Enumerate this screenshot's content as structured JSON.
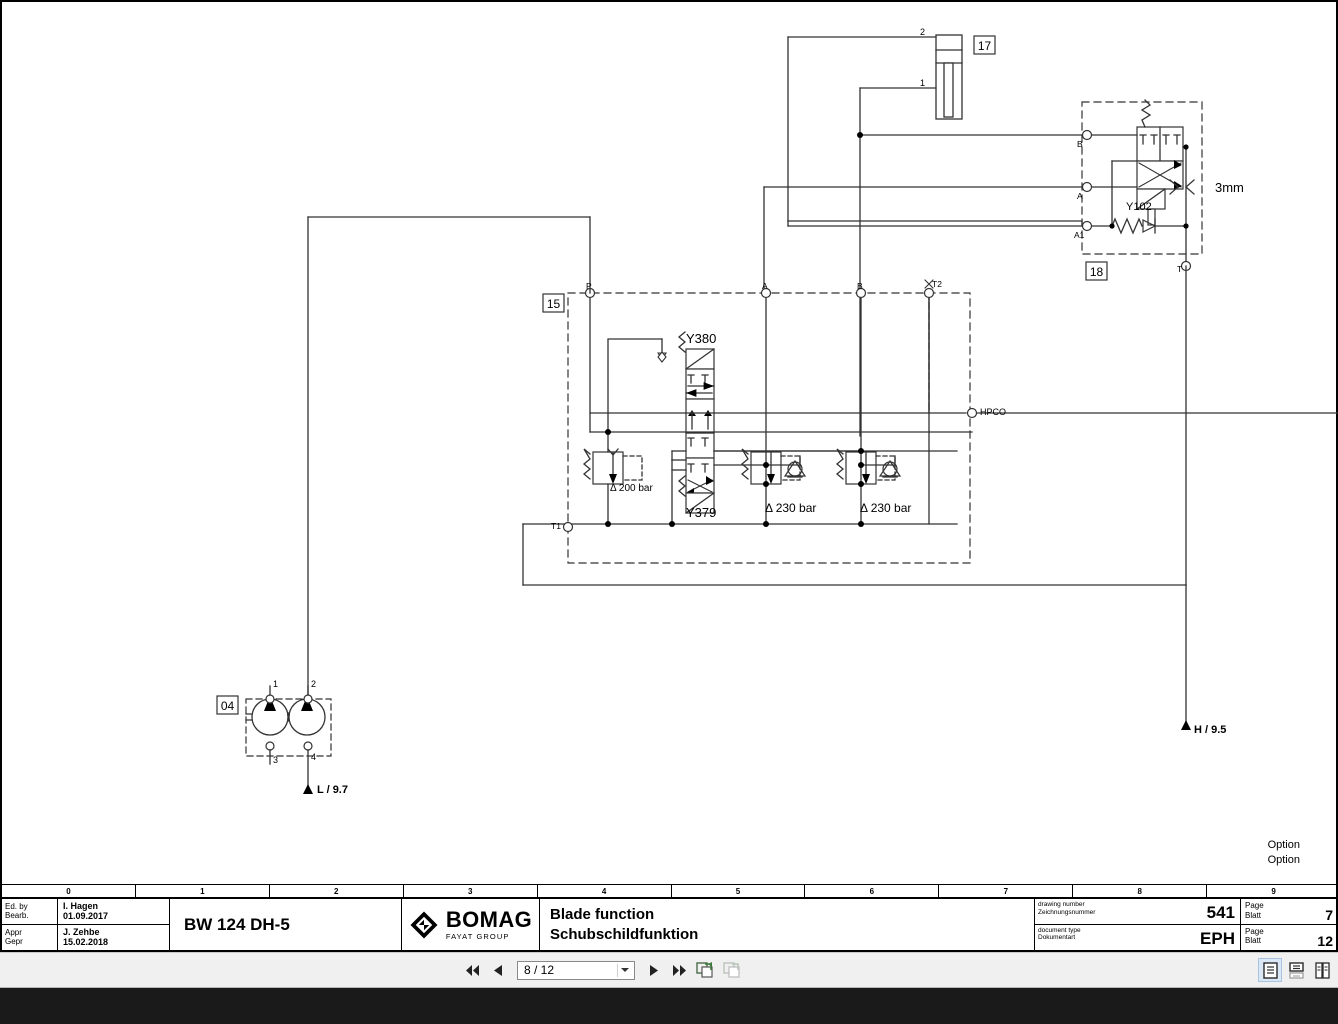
{
  "document": {
    "model": "BW 124 DH-5",
    "title_en": "Blade function",
    "title_de": "Schubschildfunktion",
    "brand": "BOMAG",
    "brand_sub": "FAYAT GROUP",
    "edited_by_label_en": "Ed. by",
    "edited_by_label_de": "Bearb.",
    "approved_label_en": "Appr",
    "approved_label_de": "Gepr",
    "editor_name": "I. Hagen",
    "editor_date": "01.09.2017",
    "approver_name": "J. Zehbe",
    "approver_date": "15.02.2018",
    "drawing_number_label_en": "drawing number",
    "drawing_number_label_de": "Zeichnungsnummer",
    "drawing_number": "541",
    "document_type_label_en": "document type",
    "document_type_label_de": "Dokumentart",
    "document_type": "EPH",
    "page_label_en": "Page",
    "page_label_de": "Blatt",
    "sheet_page": "7",
    "total_pages": "12",
    "columns": [
      "0",
      "1",
      "2",
      "3",
      "4",
      "5",
      "6",
      "7",
      "8",
      "9"
    ],
    "options": [
      "Option",
      "Option"
    ]
  },
  "viewer": {
    "first_page_icon": "first-page-icon",
    "prev_page_icon": "previous-page-icon",
    "next_page_icon": "next-page-icon",
    "last_page_icon": "last-page-icon",
    "page_indicator": "8 / 12",
    "page_placeholder": "8 / 12",
    "copy_icon": "copy-page-icon",
    "copy_disabled_icon": "duplicate-page-icon",
    "view_single_icon": "single-page-view-icon",
    "view_continuous_icon": "continuous-page-view-icon",
    "view_facing_icon": "facing-page-view-icon"
  },
  "schematic": {
    "components": [
      {
        "tag": "04",
        "name": "tandem-gear-pump",
        "ports": [
          "1",
          "2",
          "3",
          "4"
        ]
      },
      {
        "tag": "15",
        "name": "blade-control-valve-block"
      },
      {
        "tag": "17",
        "name": "blade-cylinder",
        "ports": [
          "1",
          "2"
        ]
      },
      {
        "tag": "18",
        "name": "float-valve-block"
      }
    ],
    "labels": {
      "solenoid_top": "Y380",
      "solenoid_bottom": "Y379",
      "solenoid_float": "Y102",
      "relief_pump": "Δ 200 bar",
      "relief_port_a": "Δ 230 bar",
      "relief_port_b": "Δ 230 bar",
      "orifice": "3mm",
      "hpco": "HPCO",
      "tank_return_ref": "L / 9.7",
      "pressure_ref": "H / 9.5"
    },
    "ports": {
      "block15": [
        "P",
        "A",
        "B",
        "T2",
        "T1",
        "HPCO"
      ],
      "block18": [
        "B",
        "A",
        "A1",
        "T"
      ]
    }
  }
}
